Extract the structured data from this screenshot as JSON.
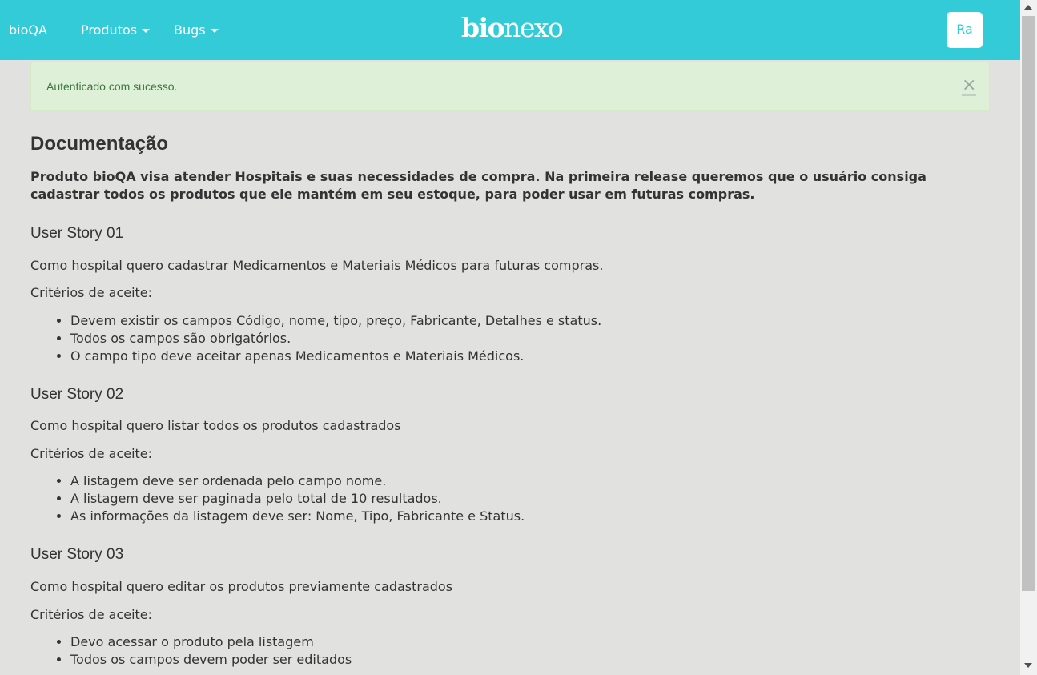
{
  "navbar": {
    "brand": "bioQA",
    "menus": [
      {
        "label": "Produtos"
      },
      {
        "label": "Bugs"
      }
    ],
    "logo": {
      "part1": "bio",
      "part2": "nexo"
    },
    "avatar_initials": "Ra"
  },
  "alert": {
    "message": "Autenticado com sucesso.",
    "close_symbol": "×"
  },
  "doc": {
    "title": "Documentação",
    "intro": "Produto bioQA visa atender Hospitais e suas necessidades de compra. Na primeira release queremos que o usuário consiga cadastrar todos os produtos que ele mantém em seu estoque, para poder usar em futuras compras.",
    "stories": [
      {
        "title": "User Story 01",
        "description": "Como hospital quero cadastrar Medicamentos e Materiais Médicos para futuras compras.",
        "criteria_label": "Critérios de aceite:",
        "criteria": [
          "Devem existir os campos Código, nome, tipo, preço, Fabricante, Detalhes e status.",
          "Todos os campos são obrigatórios.",
          "O campo tipo deve aceitar apenas Medicamentos e Materiais Médicos."
        ]
      },
      {
        "title": "User Story 02",
        "description": "Como hospital quero listar todos os produtos cadastrados",
        "criteria_label": "Critérios de aceite:",
        "criteria": [
          "A listagem deve ser ordenada pelo campo nome.",
          "A listagem deve ser paginada pelo total de 10 resultados.",
          "As informações da listagem deve ser: Nome, Tipo, Fabricante e Status."
        ]
      },
      {
        "title": "User Story 03",
        "description": "Como hospital quero editar os produtos previamente cadastrados",
        "criteria_label": "Critérios de aceite:",
        "criteria": [
          "Devo acessar o produto pela listagem",
          "Todos os campos devem poder ser editados"
        ]
      }
    ]
  },
  "colors": {
    "navbar": "#33cbd8",
    "page_background": "#e1e1df",
    "alert_background": "#dff0d8",
    "alert_text": "#3c763d"
  },
  "icons": [
    "caret-down-icon",
    "close-icon",
    "scroll-up-arrow-icon",
    "scroll-down-arrow-icon"
  ]
}
